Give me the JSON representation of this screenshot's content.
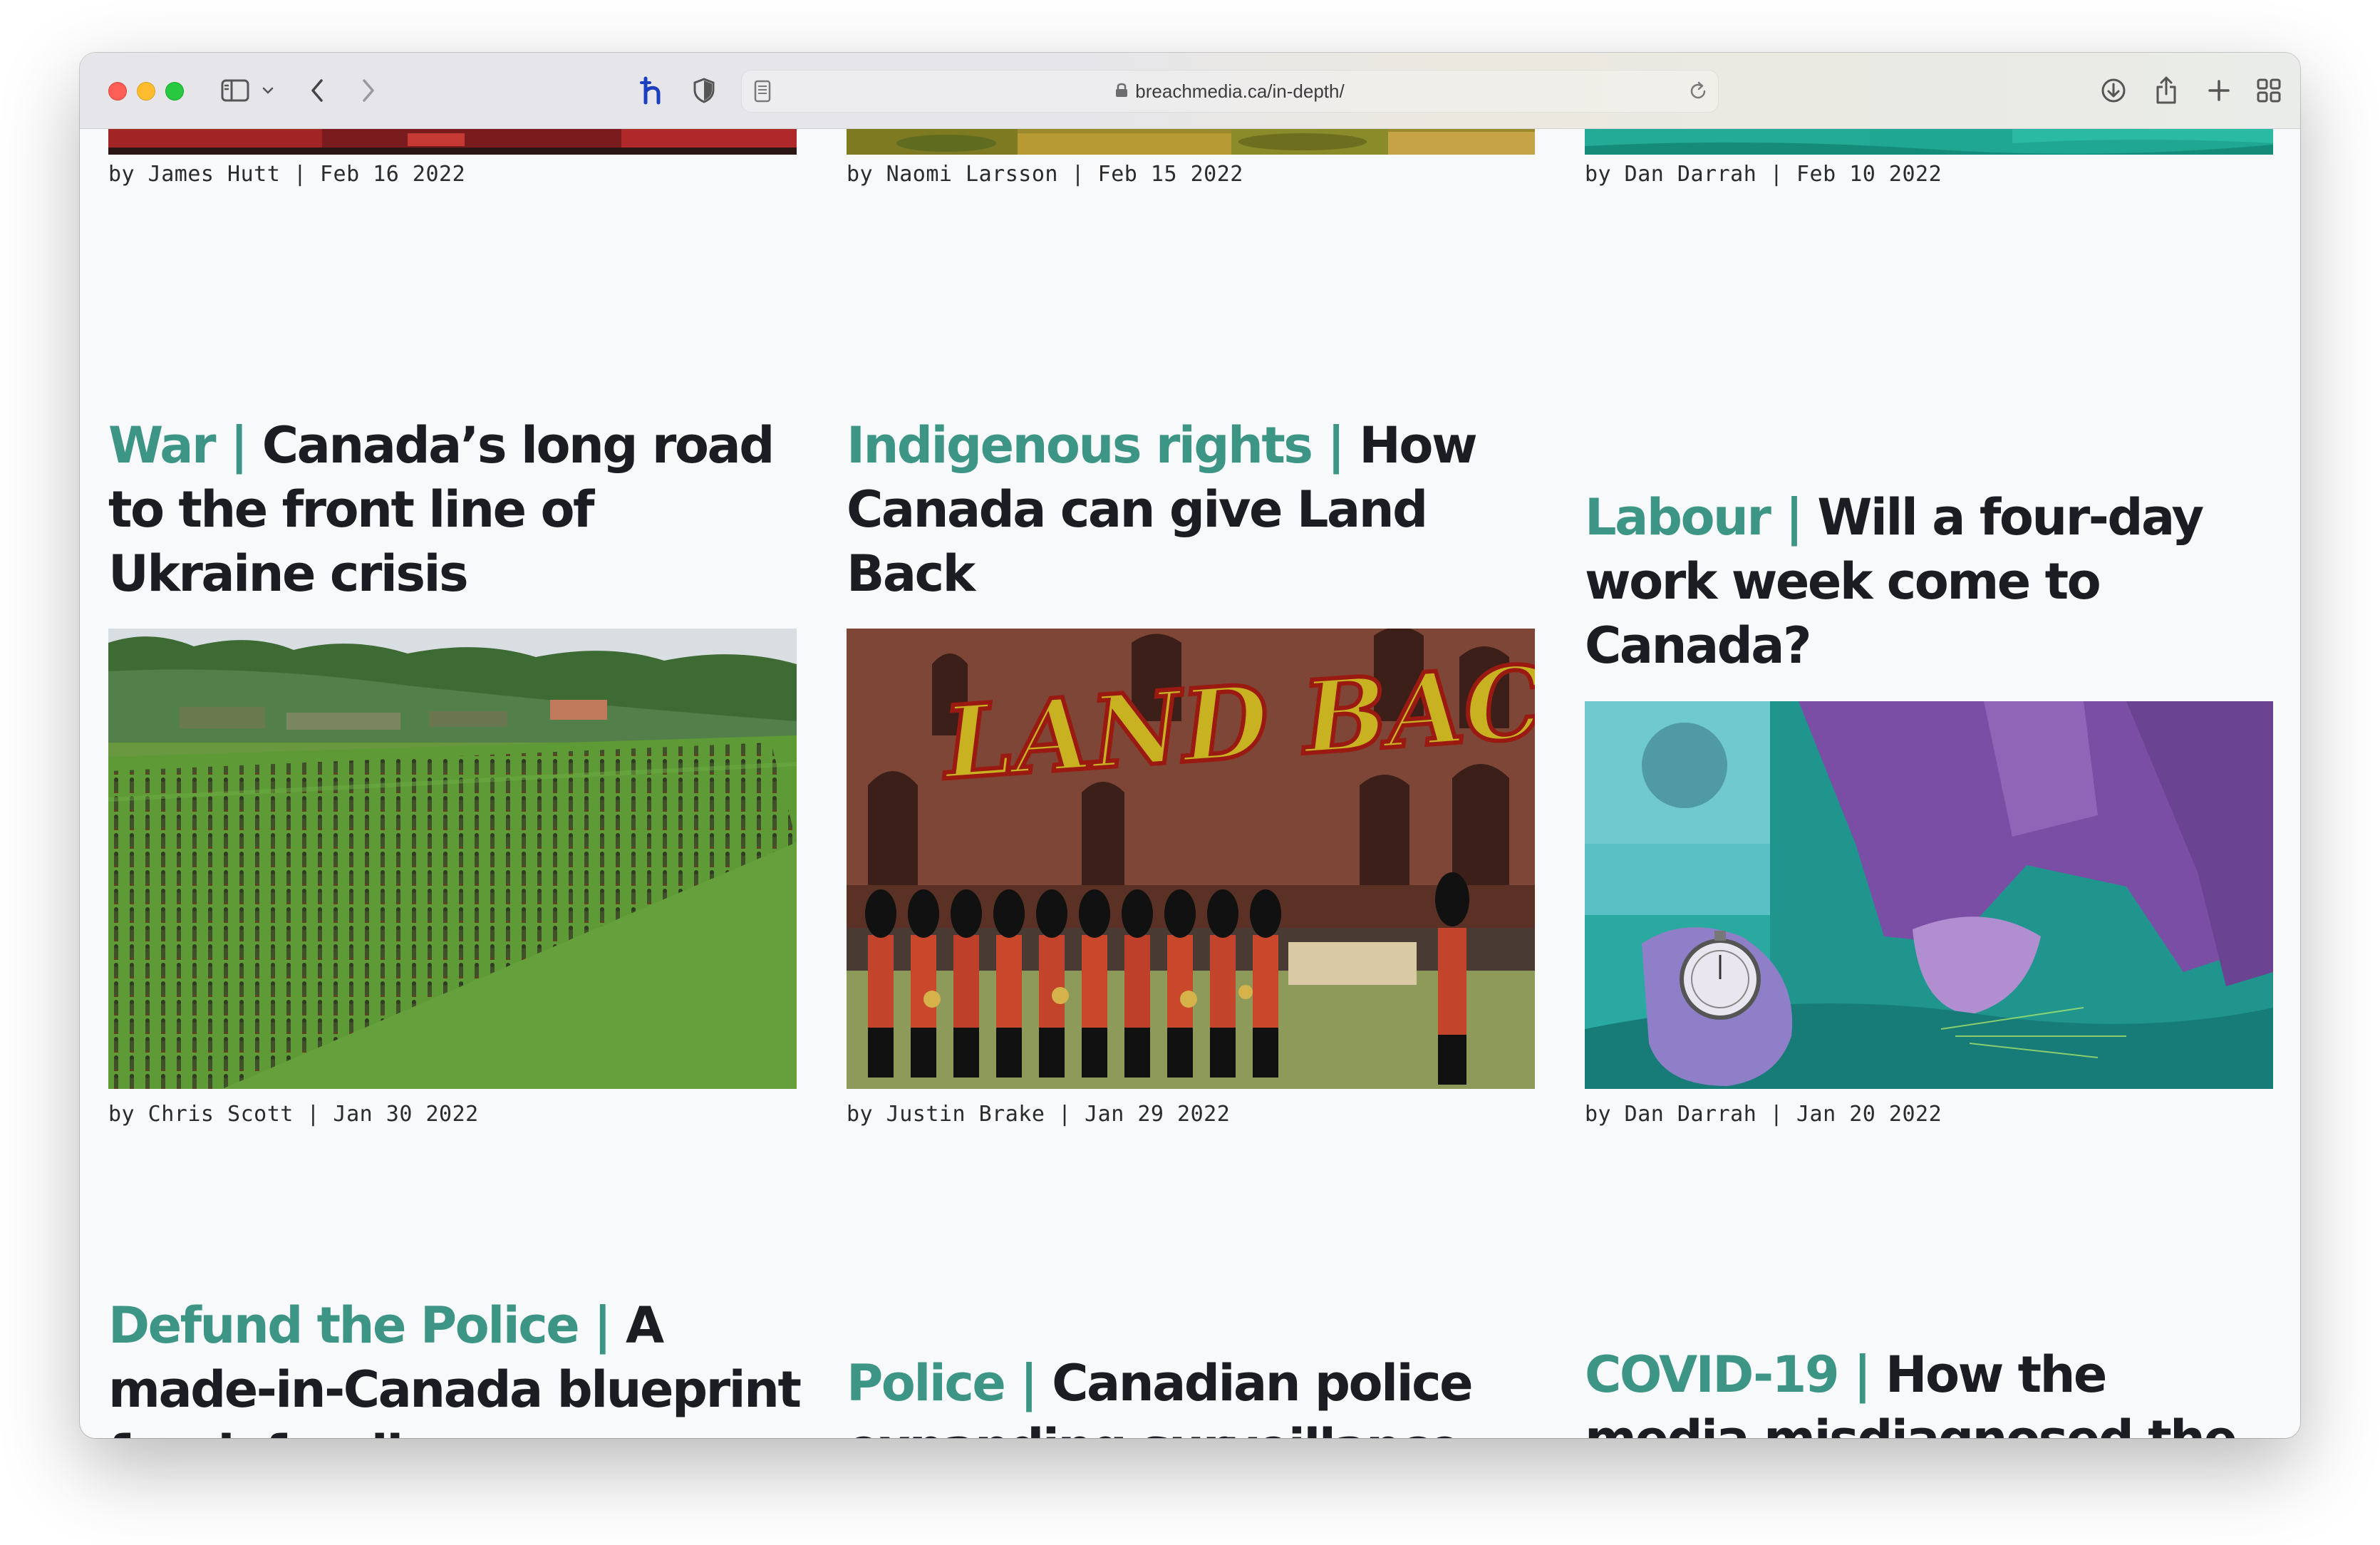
{
  "browser": {
    "url": "breachmedia.ca/in-depth/"
  },
  "articles": [
    {
      "byline": "by James Hutt | Feb 16 2022"
    },
    {
      "byline": "by Naomi Larsson | Feb 15 2022"
    },
    {
      "byline": "by Dan Darrah | Feb 10 2022"
    },
    {
      "category": "War",
      "title": "Canada’s long road to the front line of Ukraine crisis",
      "byline": "by Chris Scott | Jan 30 2022"
    },
    {
      "category": "Indigenous rights",
      "title": "How Canada can give Land Back",
      "byline": "by Justin Brake | Jan 29 2022"
    },
    {
      "category": "Labour",
      "title": "Will a four-day work week come to Canada?",
      "byline": "by Dan Darrah | Jan 20 2022"
    },
    {
      "category": "Defund the Police",
      "title": "A made-in-Canada blueprint for defunding"
    },
    {
      "category": "Police",
      "title": "Canadian police expanding surveillance"
    },
    {
      "category": "COVID-19",
      "title": "How the media misdiagnosed the"
    }
  ],
  "images": {
    "land_back_graffiti": "LAND BACK"
  },
  "colors": {
    "category": "#3d9585",
    "headline": "#1c1d22",
    "background": "#f7f9fb"
  },
  "icons": [
    "sidebar-icon",
    "chevron-down-icon",
    "back-icon",
    "forward-icon",
    "extension-h-icon",
    "shield-icon",
    "reader-icon",
    "lock-icon",
    "reload-icon",
    "download-icon",
    "share-icon",
    "new-tab-icon",
    "tab-overview-icon"
  ]
}
